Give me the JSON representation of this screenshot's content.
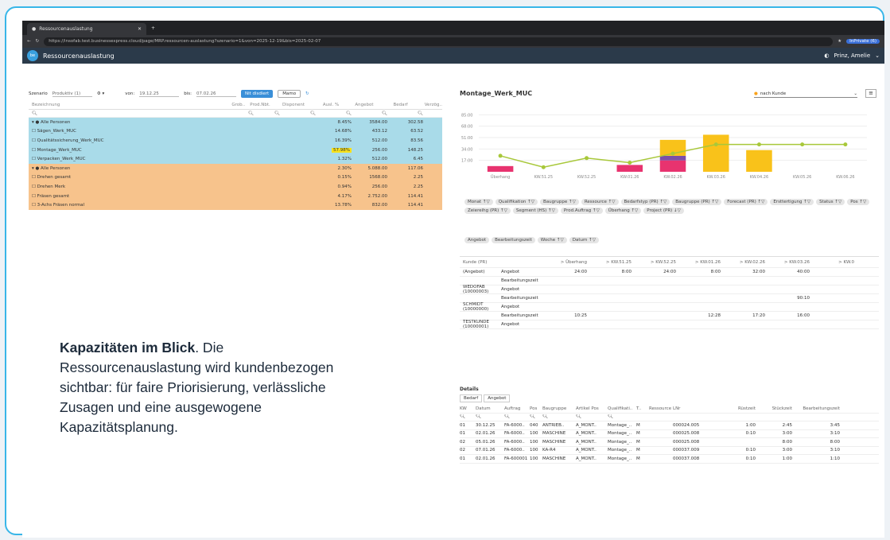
{
  "browser": {
    "tab_title": "Ressourcenauslastung",
    "url": "https://insofab.test.businessexpress.cloud/page/MRP.ressourcen-auslastung?szenario=1&von=2025-12-19&bis=2025-02-07",
    "profile": "InPrivate (6)"
  },
  "app": {
    "title": "Ressourcenauslastung",
    "user": "Prinz, Amelie"
  },
  "filters": {
    "szenario_label": "Szenario",
    "szenario_value": "Produktiv (1)",
    "von_label": "von:",
    "von_value": "19.12.25",
    "bis_label": "bis:",
    "bis_value": "07.02.26",
    "btn_primary": "Nit disdiert",
    "btn_secondary": "Mamo"
  },
  "table": {
    "headers": [
      "Bezeichnung",
      "Grob..",
      "Prod.Nbt.",
      "Disponent",
      "Ausl. %",
      "Angebot",
      "Bedarf",
      "Verzög.."
    ],
    "rows": [
      {
        "name": "Alle Personen",
        "pct": "8.45%",
        "angebot": "3584.00",
        "bedarf": "302.58",
        "color": "b"
      },
      {
        "name": "Sägen_Werk_MUC",
        "pct": "14.68%",
        "angebot": "433.12",
        "bedarf": "63.52",
        "color": "b"
      },
      {
        "name": "Qualitätssicherung_Werk_MUC",
        "pct": "16.39%",
        "angebot": "512.00",
        "bedarf": "83.56",
        "color": "b"
      },
      {
        "name": "Montage_Werk_MUC",
        "pct": "57.98%",
        "angebot": "256.00",
        "bedarf": "148.25",
        "color": "b",
        "hl": true
      },
      {
        "name": "Verpacken_Werk_MUC",
        "pct": "1.32%",
        "angebot": "512.00",
        "bedarf": "6.45",
        "color": "b"
      },
      {
        "name": "Alle Personen",
        "pct": "2.30%",
        "angebot": "5.088.00",
        "bedarf": "117.06",
        "color": "o"
      },
      {
        "name": "Drehen gesamt",
        "pct": "0.15%",
        "angebot": "1568.00",
        "bedarf": "2.25",
        "color": "o"
      },
      {
        "name": "Drehen Merk",
        "pct": "0.94%",
        "angebot": "256.00",
        "bedarf": "2.25",
        "color": "o"
      },
      {
        "name": "Fräsen gesamt",
        "pct": "4.17%",
        "angebot": "2.752.00",
        "bedarf": "114.41",
        "color": "o"
      },
      {
        "name": "3-Achs Fräsen normal",
        "pct": "13.78%",
        "angebot": "832.00",
        "bedarf": "114.41",
        "color": "o"
      }
    ]
  },
  "promo": {
    "bold": "Kapazitäten im Blick",
    "text": ". Die Ressourcenauslastung wird kundenbezogen sichtbar: für faire Priorisierung, verlässliche Zusagen und eine ausgewogene Kapazitätsplanung."
  },
  "right": {
    "title": "Montage_Werk_MUC",
    "select_value": "nach Kunde",
    "chips1": [
      "Monat ↑▽",
      "Qualifikation ↑▽",
      "Baugruppe ↑▽",
      "Ressource ↑▽",
      "Bedarfstyp (PR) ↑▽",
      "Baugruppe (PR) ↑▽",
      "Forecast (PR) ↑▽",
      "Ersttertigung ↑▽",
      "Status ↑▽",
      "Pos ↑▽",
      "Zeiereihg (PR) ↑▽",
      "Segment (HS) ↑▽",
      "Prod.Auftrag ↑▽",
      "Überhang ↑▽",
      "Project (PR) ↓▽"
    ],
    "chips2": [
      "Angebot",
      "Bearbeitungszeit",
      "Woche ↑▽",
      "Datum ↑▽"
    ],
    "grid_header": [
      "Kunde (PR)",
      "> Überhang",
      "> KW.51.25",
      "> KW.52.25",
      "> KW.01.26",
      "> KW.02.26",
      "> KW.03.26",
      "> KW.0"
    ],
    "grid_rows": [
      {
        "l1": "(Angebot)",
        "l2": "Angebot",
        "v": [
          "24:00",
          "8:00",
          "24:00",
          "8:00",
          "32:00",
          "40:00",
          ""
        ]
      },
      {
        "l1": "",
        "l2": "Bearbeitungszeit",
        "v": [
          "",
          "",
          "",
          "",
          "",
          "",
          ""
        ]
      },
      {
        "l1": "WEDOFAB (10000003)",
        "l2": "Angebot",
        "v": [
          "",
          "",
          "",
          "",
          "",
          "",
          ""
        ]
      },
      {
        "l1": "",
        "l2": "Bearbeitungszeit",
        "v": [
          "",
          "",
          "",
          "",
          "",
          "90:10",
          ""
        ]
      },
      {
        "l1": "SCHMIDT (10000000)",
        "l2": "Angebot",
        "v": [
          "",
          "",
          "",
          "",
          "",
          "",
          ""
        ]
      },
      {
        "l1": "",
        "l2": "Bearbeitungszeit",
        "v": [
          "10:25",
          "",
          "",
          "12:28",
          "17:20",
          "16:00",
          ""
        ]
      },
      {
        "l1": "TESTKUNDE (10000001)",
        "l2": "Angebot",
        "v": [
          "",
          "",
          "",
          "",
          "",
          "",
          ""
        ]
      }
    ]
  },
  "details": {
    "title": "Details",
    "tabs": [
      "Bedarf",
      "Angebot"
    ],
    "headers": [
      "KW",
      "Datum",
      "Auftrag",
      "Pos",
      "Baugruppe",
      "Artikel Pos",
      "Qualifikati..",
      "T..",
      "Ressource",
      "LNr",
      "Rüstzeit",
      "Stückzeit",
      "Bearbeitungszeit"
    ],
    "rows": [
      [
        "01",
        "30.12.25",
        "FA-6000..",
        "040",
        "ANTRIEB..",
        "A_MONT..",
        "Montage_..",
        "M",
        "",
        "000024.005",
        "1:00",
        "2:45",
        "3:45"
      ],
      [
        "01",
        "02.01.26",
        "FA-6000..",
        "100",
        "MASCHINE",
        "A_MONT..",
        "Montage_..",
        "M",
        "",
        "000025.008",
        "0:10",
        "3:00",
        "3:10"
      ],
      [
        "02",
        "05.01.26",
        "FA-6000..",
        "100",
        "MASCHINE",
        "A_MONT..",
        "Montage_..",
        "M",
        "",
        "000025.008",
        "",
        "8:00",
        "8:00"
      ],
      [
        "02",
        "07.01.26",
        "FA-6000..",
        "100",
        "KA-R4",
        "A_MONT..",
        "Montage_..",
        "M",
        "",
        "000037.009",
        "0:10",
        "3:00",
        "3:10"
      ],
      [
        "01",
        "02.01.26",
        "FA-600001",
        "100",
        "MASCHINE",
        "A_MONT..",
        "Montage_..",
        "M",
        "",
        "000037.008",
        "0:10",
        "1:00",
        "1:10"
      ]
    ]
  },
  "chart_data": {
    "type": "bar",
    "categories": [
      "Überhang",
      "KW.51.25",
      "KW.52.25",
      "KW.01.26",
      "KW.02.26",
      "KW.03.26",
      "KW.04.26",
      "KW.05.26",
      "KW.06.26"
    ],
    "ylim": [
      0,
      120
    ],
    "yticks": [
      "17:00",
      "34:00",
      "51:00",
      "68:00",
      "85:00"
    ],
    "series": [
      {
        "color": "#e8336f",
        "values": [
          10,
          0,
          0,
          12,
          20,
          0,
          0,
          0,
          0
        ]
      },
      {
        "color": "#7b4fa8",
        "values": [
          0,
          0,
          0,
          0,
          8,
          0,
          0,
          0,
          0
        ]
      },
      {
        "color": "#f9c21a",
        "values": [
          0,
          0,
          0,
          0,
          28,
          65,
          38,
          0,
          0
        ]
      }
    ],
    "line": {
      "color": "#a8c83a",
      "values": [
        28,
        8,
        24,
        16,
        32,
        48,
        48,
        48,
        48
      ]
    }
  }
}
